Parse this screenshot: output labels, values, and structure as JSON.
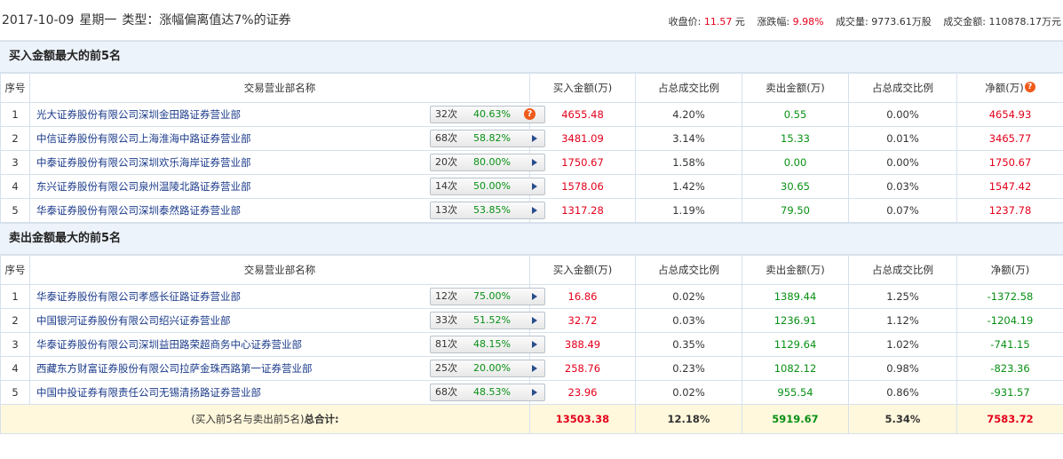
{
  "header": {
    "date": "2017-10-09",
    "weekday": "星期一",
    "type_label": "类型：涨幅偏离值达7%的证券",
    "close_label": "收盘价:",
    "close_value": "11.57",
    "close_unit": "元",
    "change_label": "涨跌幅:",
    "change_value": "9.98%",
    "volume_label": "成交量:",
    "volume_value": "9773.61万股",
    "amount_label": "成交金额:",
    "amount_value": "110878.17万元"
  },
  "columns": {
    "no": "序号",
    "dept": "交易营业部名称",
    "buy": "买入金额(万)",
    "buy_pct": "占总成交比例",
    "sell": "卖出金额(万)",
    "sell_pct": "占总成交比例",
    "net": "净额(万)"
  },
  "buy_section": {
    "title": "买入金额最大的前5名",
    "rows": [
      {
        "no": "1",
        "name": "光大证券股份有限公司深圳金田路证券营业部",
        "count": "32次",
        "rate": "40.63%",
        "buy": "4655.48",
        "buy_pct": "4.20%",
        "sell": "0.55",
        "sell_pct": "0.00%",
        "net": "4654.93"
      },
      {
        "no": "2",
        "name": "中信证券股份有限公司上海淮海中路证券营业部",
        "count": "68次",
        "rate": "58.82%",
        "buy": "3481.09",
        "buy_pct": "3.14%",
        "sell": "15.33",
        "sell_pct": "0.01%",
        "net": "3465.77"
      },
      {
        "no": "3",
        "name": "中泰证券股份有限公司深圳欢乐海岸证券营业部",
        "count": "20次",
        "rate": "80.00%",
        "buy": "1750.67",
        "buy_pct": "1.58%",
        "sell": "0.00",
        "sell_pct": "0.00%",
        "net": "1750.67"
      },
      {
        "no": "4",
        "name": "东兴证券股份有限公司泉州温陵北路证券营业部",
        "count": "14次",
        "rate": "50.00%",
        "buy": "1578.06",
        "buy_pct": "1.42%",
        "sell": "30.65",
        "sell_pct": "0.03%",
        "net": "1547.42"
      },
      {
        "no": "5",
        "name": "华泰证券股份有限公司深圳泰然路证券营业部",
        "count": "13次",
        "rate": "53.85%",
        "buy": "1317.28",
        "buy_pct": "1.19%",
        "sell": "79.50",
        "sell_pct": "0.07%",
        "net": "1237.78"
      }
    ]
  },
  "sell_section": {
    "title": "卖出金额最大的前5名",
    "rows": [
      {
        "no": "1",
        "name": "华泰证券股份有限公司孝感长征路证券营业部",
        "count": "12次",
        "rate": "75.00%",
        "buy": "16.86",
        "buy_pct": "0.02%",
        "sell": "1389.44",
        "sell_pct": "1.25%",
        "net": "-1372.58"
      },
      {
        "no": "2",
        "name": "中国银河证券股份有限公司绍兴证券营业部",
        "count": "33次",
        "rate": "51.52%",
        "buy": "32.72",
        "buy_pct": "0.03%",
        "sell": "1236.91",
        "sell_pct": "1.12%",
        "net": "-1204.19"
      },
      {
        "no": "3",
        "name": "华泰证券股份有限公司深圳益田路荣超商务中心证券营业部",
        "count": "81次",
        "rate": "48.15%",
        "buy": "388.49",
        "buy_pct": "0.35%",
        "sell": "1129.64",
        "sell_pct": "1.02%",
        "net": "-741.15"
      },
      {
        "no": "4",
        "name": "西藏东方财富证券股份有限公司拉萨金珠西路第一证券营业部",
        "count": "25次",
        "rate": "20.00%",
        "buy": "258.76",
        "buy_pct": "0.23%",
        "sell": "1082.12",
        "sell_pct": "0.98%",
        "net": "-823.36"
      },
      {
        "no": "5",
        "name": "中国中投证券有限责任公司无锡清扬路证券营业部",
        "count": "68次",
        "rate": "48.53%",
        "buy": "23.96",
        "buy_pct": "0.02%",
        "sell": "955.54",
        "sell_pct": "0.86%",
        "net": "-931.57"
      }
    ]
  },
  "total": {
    "label_prefix": "(买入前5名与卖出前5名)",
    "label_bold": "总合计:",
    "buy": "13503.38",
    "buy_pct": "12.18%",
    "sell": "5919.67",
    "sell_pct": "5.34%",
    "net": "7583.72"
  },
  "colors": {
    "up": "#e3001b",
    "down": "#089014",
    "link": "#1a3a8a",
    "header_bg": "#edf3fa",
    "total_bg": "#fff8dc"
  },
  "icons": {
    "help": "question-circle-icon",
    "expand": "triangle-right-icon"
  }
}
